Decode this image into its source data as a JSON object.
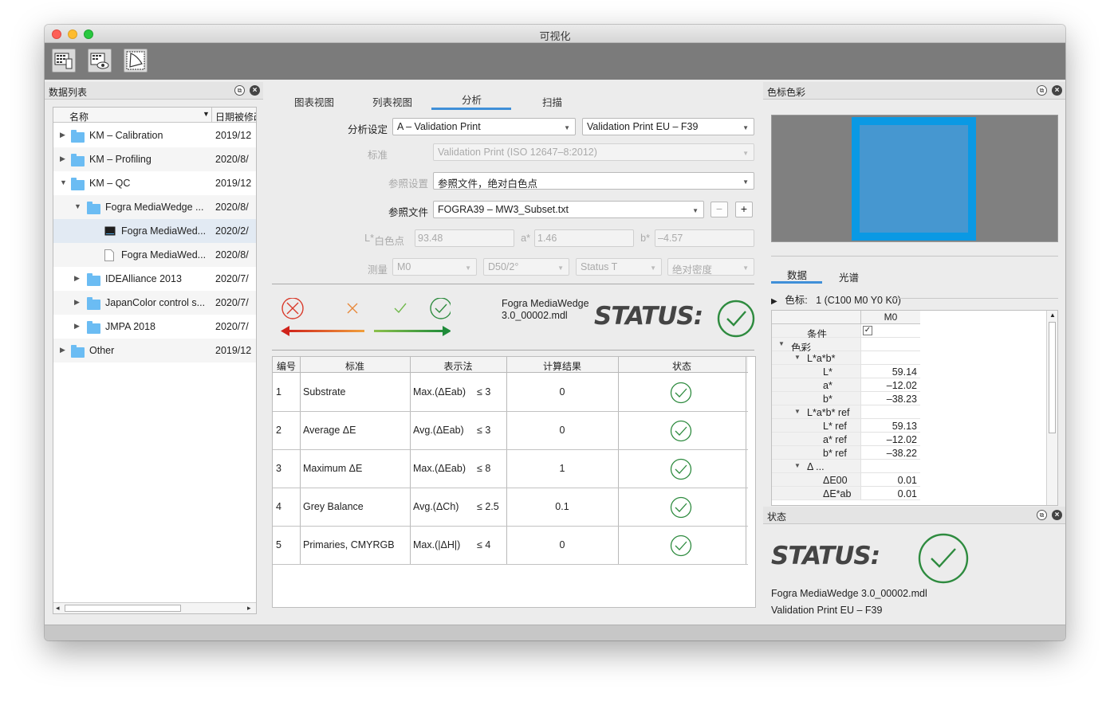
{
  "window": {
    "title": "可视化"
  },
  "toolbar": {
    "buttons": [
      "measure-chart-icon",
      "view-chart-icon",
      "gamut-view-icon"
    ]
  },
  "left_panel": {
    "title": "数据列表",
    "columns": {
      "name": "名称",
      "date": "日期被修改"
    },
    "rows": [
      {
        "name": "KM – Calibration",
        "date": "2019/12",
        "type": "folder"
      },
      {
        "name": "KM – Profiling",
        "date": "2020/8/",
        "type": "folder"
      },
      {
        "name": "KM – QC",
        "date": "2019/12",
        "type": "folder"
      },
      {
        "name": "Fogra MediaWedge ...",
        "date": "2020/8/",
        "type": "folder"
      },
      {
        "name": "Fogra MediaWed...",
        "date": "2020/2/",
        "type": "measure-file"
      },
      {
        "name": "Fogra MediaWed...",
        "date": "2020/8/",
        "type": "document"
      },
      {
        "name": "IDEAlliance 2013",
        "date": "2020/7/",
        "type": "folder"
      },
      {
        "name": "JapanColor control s...",
        "date": "2020/7/",
        "type": "folder"
      },
      {
        "name": "JMPA 2018",
        "date": "2020/7/",
        "type": "folder"
      },
      {
        "name": "Other",
        "date": "2019/12",
        "type": "folder"
      }
    ]
  },
  "center_panel": {
    "tabs": [
      "图表视图",
      "列表视图",
      "分析",
      "扫描"
    ],
    "active_tab": "分析",
    "analysis_setting": {
      "label": "分析设定",
      "value1": "A – Validation Print",
      "value2": "Validation Print EU – F39"
    },
    "standard": {
      "label": "标准",
      "value": "Validation Print (ISO 12647–8:2012)"
    },
    "reference_setting": {
      "label": "参照设置",
      "value": "参照文件，绝对白色点"
    },
    "reference_file": {
      "label": "参照文件",
      "value": "FOGRA39 – MW3_Subset.txt",
      "minus": "−",
      "plus": "+"
    },
    "white_point": {
      "label": "白色点",
      "l_label": "L*",
      "l_value": "93.48",
      "a_label": "a*",
      "a_value": "1.46",
      "b_label": "b*",
      "b_value": "–4.57"
    },
    "measurement": {
      "label": "测量",
      "mode": "M0",
      "illuminant": "D50/2°",
      "status": "Status T",
      "density": "绝对密度"
    },
    "file_name_line1": "Fogra MediaWedge",
    "file_name_line2": "3.0_00002.mdl",
    "status_label": "STATUS:",
    "table": {
      "headers": [
        "编号",
        "标准",
        "表示法",
        "计算结果",
        "状态"
      ],
      "rows": [
        {
          "num": "1",
          "name": "Substrate",
          "method": "Max.(ΔEab)",
          "limit": "≤ 3",
          "result": "0",
          "status": "pass"
        },
        {
          "num": "2",
          "name": "Average ΔE",
          "method": "Avg.(ΔEab)",
          "limit": "≤ 3",
          "result": "0",
          "status": "pass"
        },
        {
          "num": "3",
          "name": "Maximum ΔE",
          "method": "Max.(ΔEab)",
          "limit": "≤ 8",
          "result": "1",
          "status": "pass"
        },
        {
          "num": "4",
          "name": "Grey Balance",
          "method": "Avg.(ΔCh)",
          "limit": "≤ 2.5",
          "result": "0.1",
          "status": "pass"
        },
        {
          "num": "5",
          "name": "Primaries, CMYRGB",
          "method": "Max.(|ΔH|)",
          "limit": "≤ 4",
          "result": "0",
          "status": "pass"
        }
      ]
    }
  },
  "right_panel": {
    "title": "色标色彩",
    "tabs": [
      "数据",
      "光谱"
    ],
    "patch_label": "色标:",
    "patch_value": "1 (C100 M0 Y0 K0)",
    "column_header": "M0",
    "rows": [
      {
        "label": "条件",
        "value": "✓",
        "level": 1
      },
      {
        "label": "色彩",
        "value": "",
        "level": 0
      },
      {
        "label": "L*a*b*",
        "value": "",
        "level": 1
      },
      {
        "label": "L*",
        "value": "59.14",
        "level": 2
      },
      {
        "label": "a*",
        "value": "–12.02",
        "level": 2
      },
      {
        "label": "b*",
        "value": "–38.23",
        "level": 2
      },
      {
        "label": "L*a*b* ref",
        "value": "",
        "level": 1
      },
      {
        "label": "L* ref",
        "value": "59.13",
        "level": 2
      },
      {
        "label": "a* ref",
        "value": "–12.02",
        "level": 2
      },
      {
        "label": "b* ref",
        "value": "–38.22",
        "level": 2
      },
      {
        "label": "Δ ...",
        "value": "",
        "level": 1
      },
      {
        "label": "ΔE00",
        "value": "0.01",
        "level": 2
      },
      {
        "label": "ΔE*ab",
        "value": "0.01",
        "level": 2
      }
    ],
    "status_panel": {
      "title": "状态",
      "status_label": "STATUS:",
      "file": "Fogra MediaWedge 3.0_00002.mdl",
      "reference": "Validation Print EU – F39"
    }
  },
  "colors": {
    "pass_green": "#2e8b3f",
    "fail_red": "#d93a2b",
    "warn_orange": "#e8883a",
    "accent_blue": "#3f8fd8",
    "patch_cyan": "#0a99e4"
  }
}
